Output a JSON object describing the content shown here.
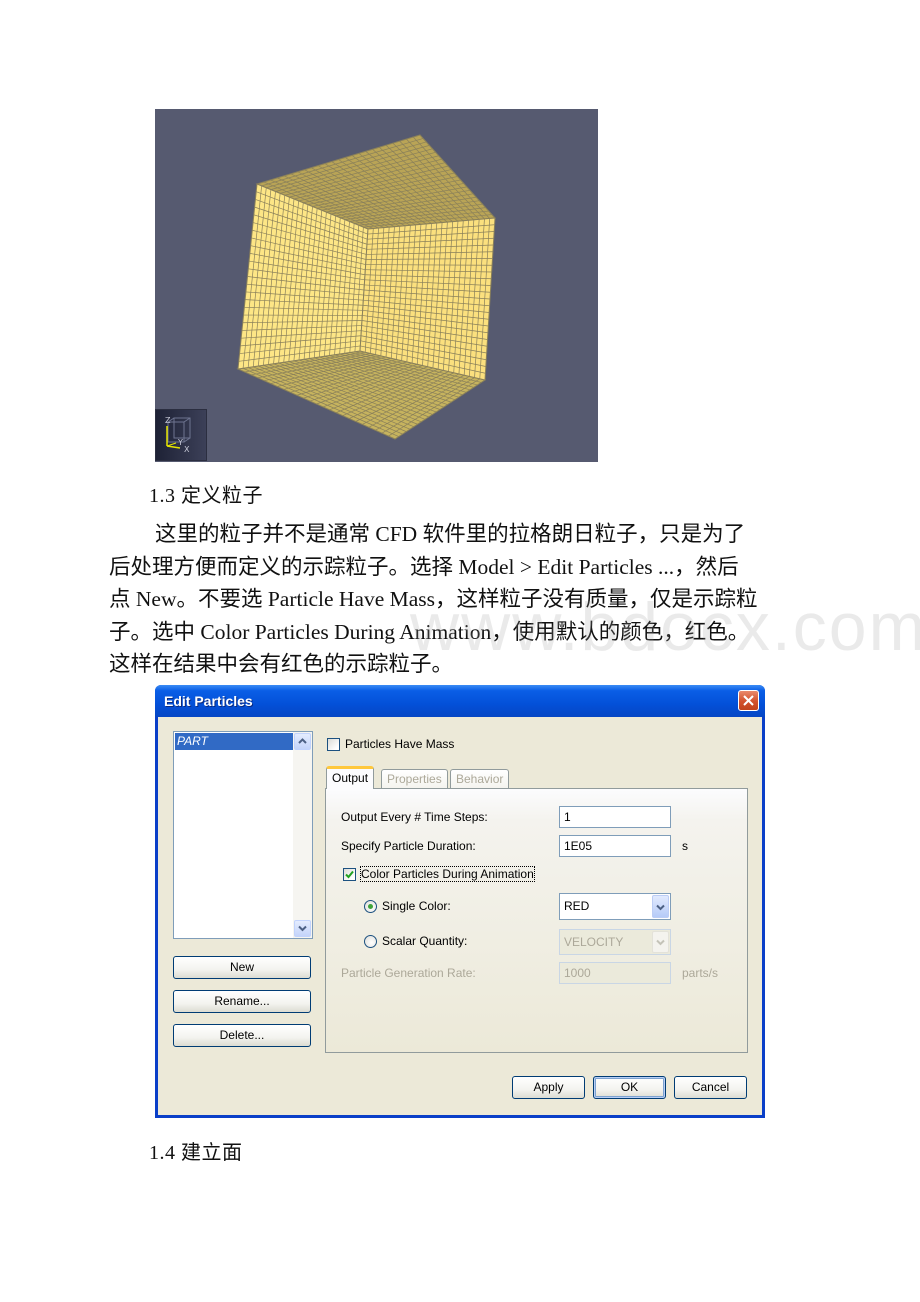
{
  "figure": {
    "background_color": "#565a70",
    "surface_color": "#fde686",
    "grid_line_color": "#8a805a",
    "axis_labels": {
      "z": "Z",
      "y": "Y",
      "x": "X"
    }
  },
  "section_1_3": {
    "heading": "1.3 定义粒子",
    "paragraph_lines": [
      "这里的粒子并不是通常 CFD 软件里的拉格朗日粒子，只是为了",
      "后处理方便而定义的示踪粒子。选择 Model > Edit Particles ...，然后",
      "点 New。不要选 Particle Have Mass，这样粒子没有质量，仅是示踪粒",
      "子。选中 Color Particles During Animation，使用默认的颜色，红色。",
      "这样在结果中会有红色的示踪粒子。"
    ]
  },
  "watermark": "www.bdocx.com",
  "dialog": {
    "title": "Edit Particles",
    "particle_list": {
      "items": [
        "PART"
      ],
      "selected": "PART"
    },
    "list_buttons": {
      "new": "New",
      "rename": "Rename...",
      "delete": "Delete..."
    },
    "particles_have_mass": {
      "label": "Particles Have Mass",
      "checked": false
    },
    "tabs": [
      {
        "label": "Output",
        "active": true
      },
      {
        "label": "Properties",
        "active": false
      },
      {
        "label": "Behavior",
        "active": false
      }
    ],
    "output": {
      "time_steps_label": "Output Every # Time Steps:",
      "time_steps_value": "1",
      "duration_label": "Specify Particle Duration:",
      "duration_value": "1E05",
      "duration_unit": "s",
      "color_during_animation": {
        "label": "Color Particles During Animation",
        "checked": true
      },
      "single_color": {
        "label": "Single Color:",
        "selected": true,
        "value": "RED"
      },
      "scalar_quantity": {
        "label": "Scalar Quantity:",
        "selected": false,
        "value": "VELOCITY"
      },
      "generation_rate_label": "Particle Generation Rate:",
      "generation_rate_value": "1000",
      "generation_rate_unit": "parts/s"
    },
    "footer_buttons": {
      "apply": "Apply",
      "ok": "OK",
      "cancel": "Cancel"
    }
  },
  "section_1_4": {
    "heading": "1.4 建立面"
  }
}
